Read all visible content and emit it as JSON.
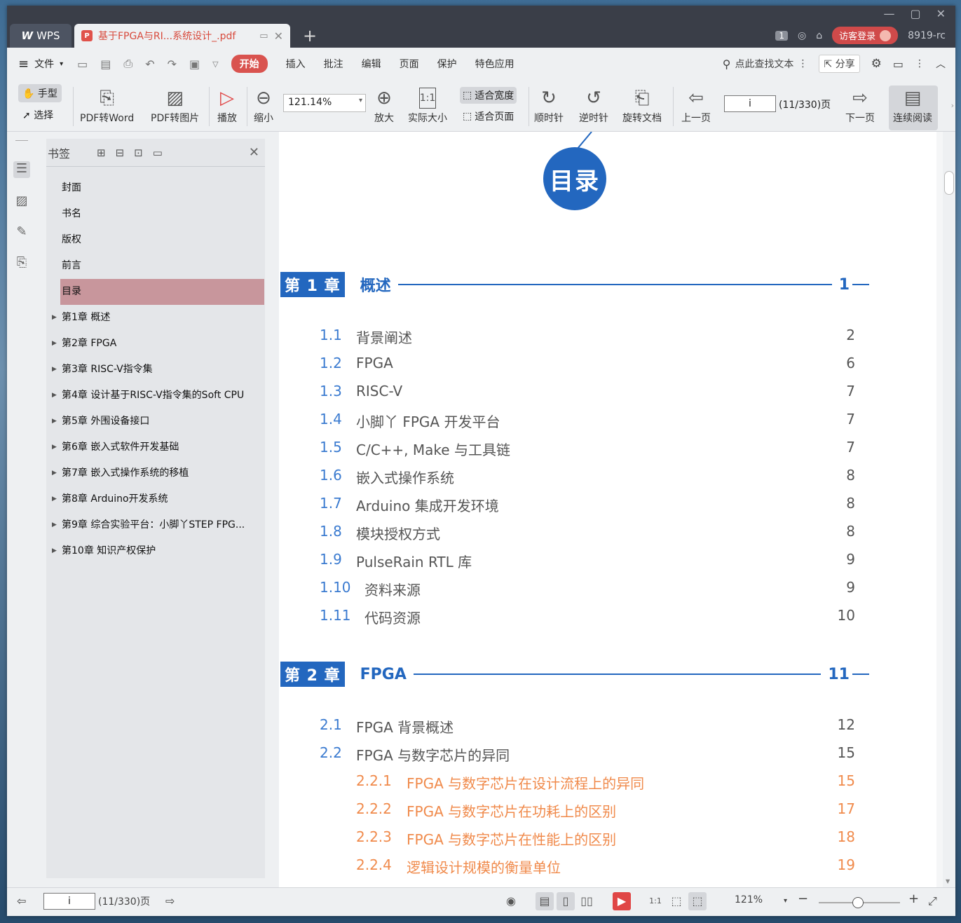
{
  "tabs": {
    "app_label": "WPS",
    "doc_title": "基于FPGA与RI...系统设计_.pdf",
    "add": "+"
  },
  "titlebar": {
    "counter": "1",
    "login": "访客登录",
    "user": "8919-rc"
  },
  "menu": {
    "file": "文件",
    "items": [
      "开始",
      "插入",
      "批注",
      "编辑",
      "页面",
      "保护",
      "特色应用"
    ],
    "active": "开始",
    "search": "点此查找文本",
    "share": "分享"
  },
  "toolbar": {
    "hand": "手型",
    "select": "选择",
    "pdf_to_word": "PDF转Word",
    "pdf_to_image": "PDF转图片",
    "play": "播放",
    "zoom_out": "缩小",
    "zoom_value": "121.14%",
    "zoom_in": "放大",
    "actual_size": "实际大小",
    "fit_width": "适合宽度",
    "fit_page": "适合页面",
    "clockwise": "顺时针",
    "counterclockwise": "逆时针",
    "rotate_doc": "旋转文档",
    "prev_page": "上一页",
    "page_input": "i",
    "page_total": "(11/330)页",
    "next_page": "下一页",
    "continuous": "连续阅读"
  },
  "bookmarks": {
    "title": "书签",
    "items": [
      {
        "label": "封面",
        "expandable": false
      },
      {
        "label": "书名",
        "expandable": false
      },
      {
        "label": "版权",
        "expandable": false
      },
      {
        "label": "前言",
        "expandable": false
      },
      {
        "label": "目录",
        "expandable": false,
        "selected": true
      },
      {
        "label": "第1章  概述",
        "expandable": true
      },
      {
        "label": "第2章  FPGA",
        "expandable": true
      },
      {
        "label": "第3章  RISC-V指令集",
        "expandable": true
      },
      {
        "label": "第4章  设计基于RISC-V指令集的Soft CPU",
        "expandable": true
      },
      {
        "label": "第5章  外围设备接口",
        "expandable": true
      },
      {
        "label": "第6章  嵌入式软件开发基础",
        "expandable": true
      },
      {
        "label": "第7章  嵌入式操作系统的移植",
        "expandable": true
      },
      {
        "label": "第8章  Arduino开发系统",
        "expandable": true
      },
      {
        "label": "第9章  综合实验平台：小脚丫STEP FPG...",
        "expandable": true
      },
      {
        "label": "第10章  知识产权保护",
        "expandable": true
      }
    ]
  },
  "document": {
    "toc_title": "目录",
    "chapters": [
      {
        "label": "第 1 章",
        "name": "概述",
        "page": "1",
        "entries": [
          {
            "num": "1.1",
            "title": "背景阐述",
            "page": "2"
          },
          {
            "num": "1.2",
            "title": "FPGA",
            "page": "6"
          },
          {
            "num": "1.3",
            "title": "RISC-V",
            "page": "7"
          },
          {
            "num": "1.4",
            "title": "小脚丫 FPGA 开发平台",
            "page": "7"
          },
          {
            "num": "1.5",
            "title": "C/C++, Make 与工具链",
            "page": "7"
          },
          {
            "num": "1.6",
            "title": "嵌入式操作系统",
            "page": "8"
          },
          {
            "num": "1.7",
            "title": "Arduino 集成开发环境",
            "page": "8"
          },
          {
            "num": "1.8",
            "title": "模块授权方式",
            "page": "8"
          },
          {
            "num": "1.9",
            "title": "PulseRain RTL 库",
            "page": "9"
          },
          {
            "num": "1.10",
            "title": "资料来源",
            "page": "9"
          },
          {
            "num": "1.11",
            "title": "代码资源",
            "page": "10"
          }
        ]
      },
      {
        "label": "第 2 章",
        "name": "FPGA",
        "page": "11",
        "entries": [
          {
            "num": "2.1",
            "title": "FPGA 背景概述",
            "page": "12"
          },
          {
            "num": "2.2",
            "title": "FPGA 与数字芯片的异同",
            "page": "15"
          }
        ],
        "subentries": [
          {
            "num": "2.2.1",
            "title": "FPGA 与数字芯片在设计流程上的异同",
            "page": "15"
          },
          {
            "num": "2.2.2",
            "title": "FPGA 与数字芯片在功耗上的区别",
            "page": "17"
          },
          {
            "num": "2.2.3",
            "title": "FPGA 与数字芯片在性能上的区别",
            "page": "18"
          },
          {
            "num": "2.2.4",
            "title": "逻辑设计规模的衡量单位",
            "page": "19"
          }
        ]
      }
    ]
  },
  "statusbar": {
    "page_input": "i",
    "page_total": "(11/330)页",
    "zoom": "121%",
    "zoom_level": 0.48
  },
  "colors": {
    "accent": "#2367bf",
    "sub_entry": "#f08a4b",
    "selected_bookmark": "#c8969c",
    "active_menu": "#d9534f"
  }
}
